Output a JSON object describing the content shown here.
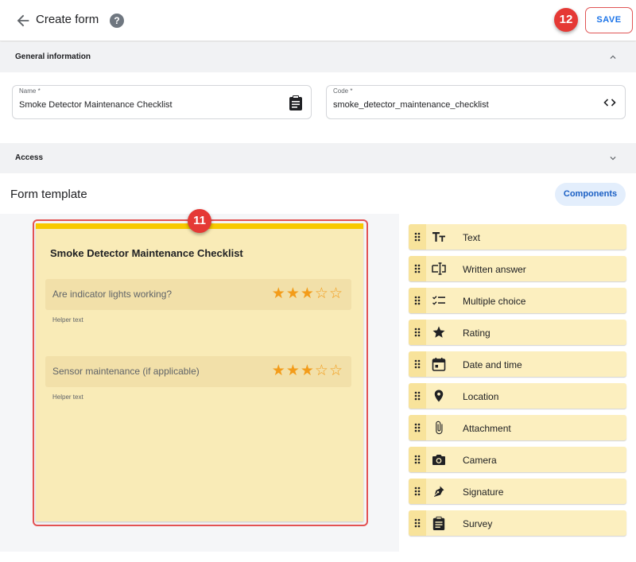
{
  "header": {
    "title": "Create form",
    "help_icon": "help-circle-icon",
    "save_label": "SAVE",
    "badge_save": "12"
  },
  "general": {
    "title": "General information",
    "name": {
      "label": "Name *",
      "value": "Smoke Detector Maintenance Checklist",
      "icon": "clipboard-icon"
    },
    "code": {
      "label": "Code *",
      "value": "smoke_detector_maintenance_checklist",
      "icon": "code-icon"
    }
  },
  "access": {
    "title": "Access"
  },
  "template": {
    "title": "Form template",
    "components_label": "Components",
    "badge_card": "11",
    "card": {
      "title": "Smoke Detector Maintenance Checklist",
      "questions": [
        {
          "text": "Are indicator lights working?",
          "helper": "Helper text",
          "rating": 3,
          "max": 5
        },
        {
          "text": "Sensor maintenance (if applicable)",
          "helper": "Helper text",
          "rating": 3,
          "max": 5
        }
      ]
    }
  },
  "components": [
    {
      "label": "Text",
      "icon": "text-format-icon"
    },
    {
      "label": "Written answer",
      "icon": "text-field-icon"
    },
    {
      "label": "Multiple choice",
      "icon": "checklist-icon"
    },
    {
      "label": "Rating",
      "icon": "star-icon"
    },
    {
      "label": "Date and time",
      "icon": "calendar-icon"
    },
    {
      "label": "Location",
      "icon": "location-pin-icon"
    },
    {
      "label": "Attachment",
      "icon": "paperclip-icon"
    },
    {
      "label": "Camera",
      "icon": "camera-icon"
    },
    {
      "label": "Signature",
      "icon": "pen-icon"
    },
    {
      "label": "Survey",
      "icon": "clipboard-icon"
    }
  ],
  "colors": {
    "accent": "#1a73e8",
    "card_bg": "#f9ebb7",
    "card_top": "#f8c900",
    "star": "#f39c1a",
    "badge": "#e53935"
  }
}
